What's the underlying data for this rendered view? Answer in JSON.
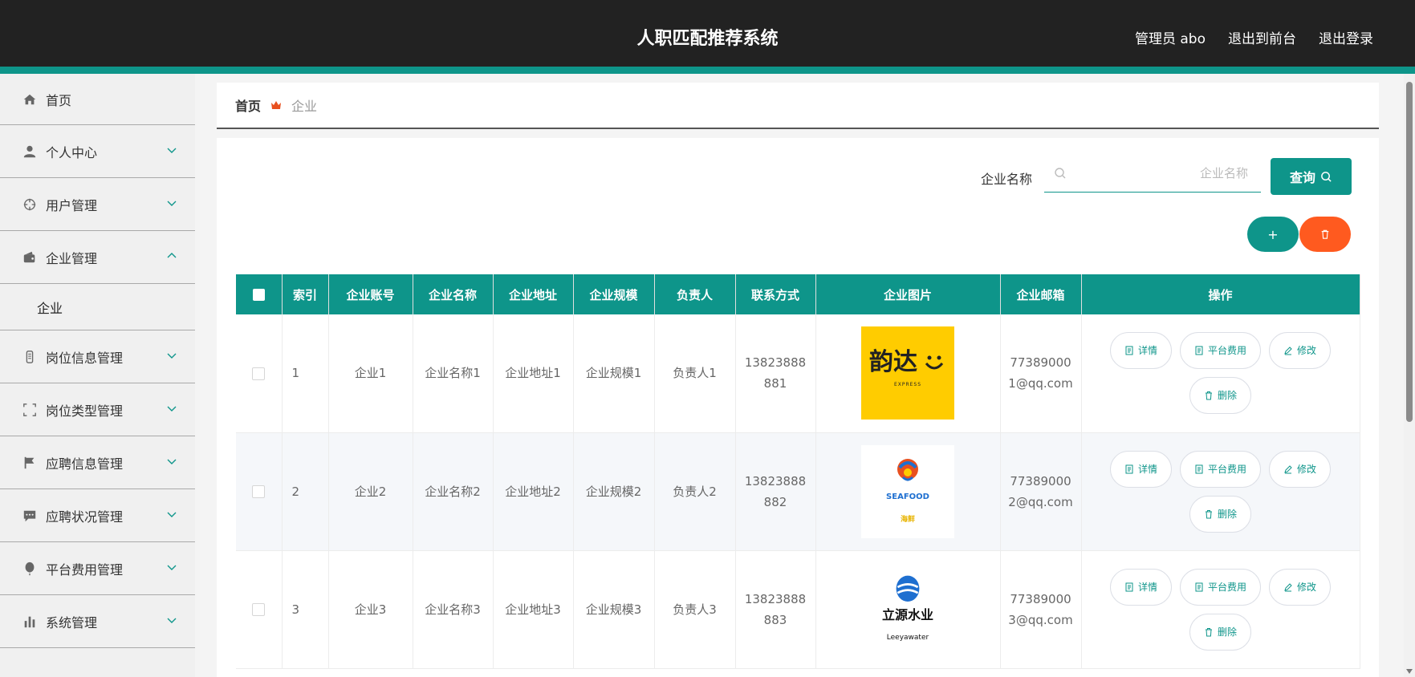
{
  "header": {
    "title": "人职匹配推荐系统",
    "admin_label": "管理员 abo",
    "exit_front": "退出到前台",
    "logout": "退出登录"
  },
  "sidebar": {
    "items": [
      {
        "label": "首页",
        "icon": "home-icon"
      },
      {
        "label": "个人中心",
        "icon": "user-icon"
      },
      {
        "label": "用户管理",
        "icon": "crosshair-icon"
      },
      {
        "label": "企业管理",
        "icon": "wallet-icon"
      },
      {
        "label": "企业",
        "icon": ""
      },
      {
        "label": "岗位信息管理",
        "icon": "phone-icon"
      },
      {
        "label": "岗位类型管理",
        "icon": "frame-icon"
      },
      {
        "label": "应聘信息管理",
        "icon": "flag-icon"
      },
      {
        "label": "应聘状况管理",
        "icon": "chat-icon"
      },
      {
        "label": "平台费用管理",
        "icon": "balloon-icon"
      },
      {
        "label": "系统管理",
        "icon": "bar-chart-icon"
      }
    ]
  },
  "breadcrumb": {
    "home": "首页",
    "current": "企业"
  },
  "search": {
    "label": "企业名称",
    "placeholder": "企业名称",
    "button": "查询"
  },
  "actions": {
    "add": "+"
  },
  "table": {
    "headers": [
      "索引",
      "企业账号",
      "企业名称",
      "企业地址",
      "企业规模",
      "负责人",
      "联系方式",
      "企业图片",
      "企业邮箱",
      "操作"
    ],
    "rows": [
      {
        "index": "1",
        "account": "企业1",
        "name": "企业名称1",
        "address": "企业地址1",
        "scale": "企业规模1",
        "manager": "负责人1",
        "phone": "13823888881",
        "email": "773890001@qq.com",
        "logo_text": "韵达",
        "logo_sub": "EXPRESS"
      },
      {
        "index": "2",
        "account": "企业2",
        "name": "企业名称2",
        "address": "企业地址2",
        "scale": "企业规模2",
        "manager": "负责人2",
        "phone": "13823888882",
        "email": "773890002@qq.com",
        "logo_text": "SEAFOOD",
        "logo_sub": "海鲜"
      },
      {
        "index": "3",
        "account": "企业3",
        "name": "企业名称3",
        "address": "企业地址3",
        "scale": "企业规模3",
        "manager": "负责人3",
        "phone": "13823888883",
        "email": "773890003@qq.com",
        "logo_text": "立源水业",
        "logo_sub": "Leeyawater"
      }
    ],
    "ops": {
      "detail": "详情",
      "fee": "平台费用",
      "edit": "修改",
      "delete": "删除"
    }
  },
  "colors": {
    "primary": "#0e958a",
    "danger": "#ff5a1f",
    "header_bg": "#222222"
  }
}
